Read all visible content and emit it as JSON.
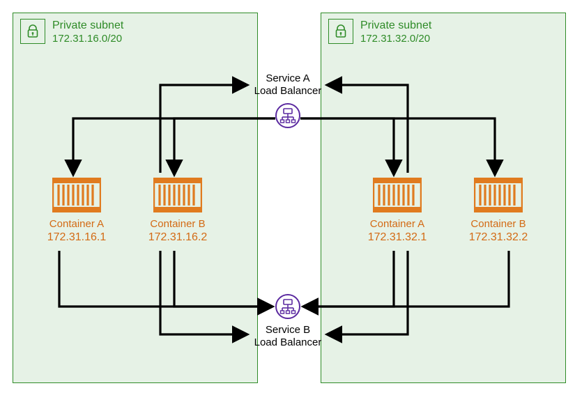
{
  "subnets": [
    {
      "title": "Private subnet",
      "cidr": "172.31.16.0/20",
      "containers": [
        {
          "name": "Container A",
          "ip": "172.31.16.1"
        },
        {
          "name": "Container B",
          "ip": "172.31.16.2"
        }
      ]
    },
    {
      "title": "Private subnet",
      "cidr": "172.31.32.0/20",
      "containers": [
        {
          "name": "Container A",
          "ip": "172.31.32.1"
        },
        {
          "name": "Container B",
          "ip": "172.31.32.2"
        }
      ]
    }
  ],
  "load_balancers": [
    {
      "name": "Service A",
      "label": "Load Balancer"
    },
    {
      "name": "Service B",
      "label": "Load Balancer"
    }
  ],
  "colors": {
    "subnet_border": "#2e8b27",
    "subnet_fill": "#e6f2e6",
    "container": "#e07b1f",
    "lb": "#5b2aa0",
    "arrow": "#000000"
  }
}
